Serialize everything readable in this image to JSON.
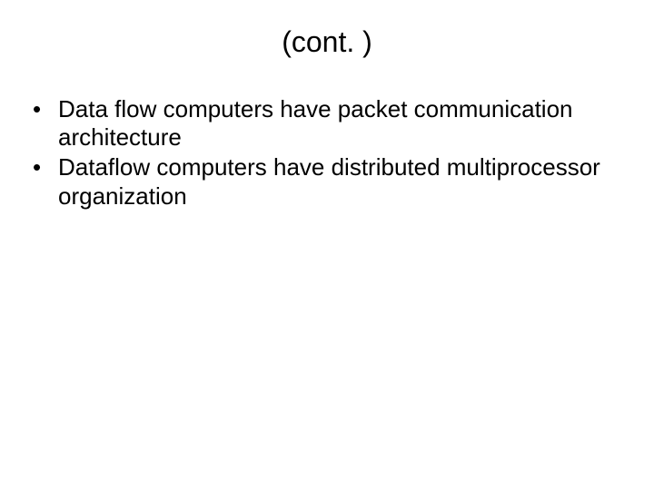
{
  "slide": {
    "title": "(cont. )",
    "bullets": [
      "Data flow computers have packet communication architecture",
      "Dataflow computers have distributed multiprocessor organization"
    ]
  }
}
